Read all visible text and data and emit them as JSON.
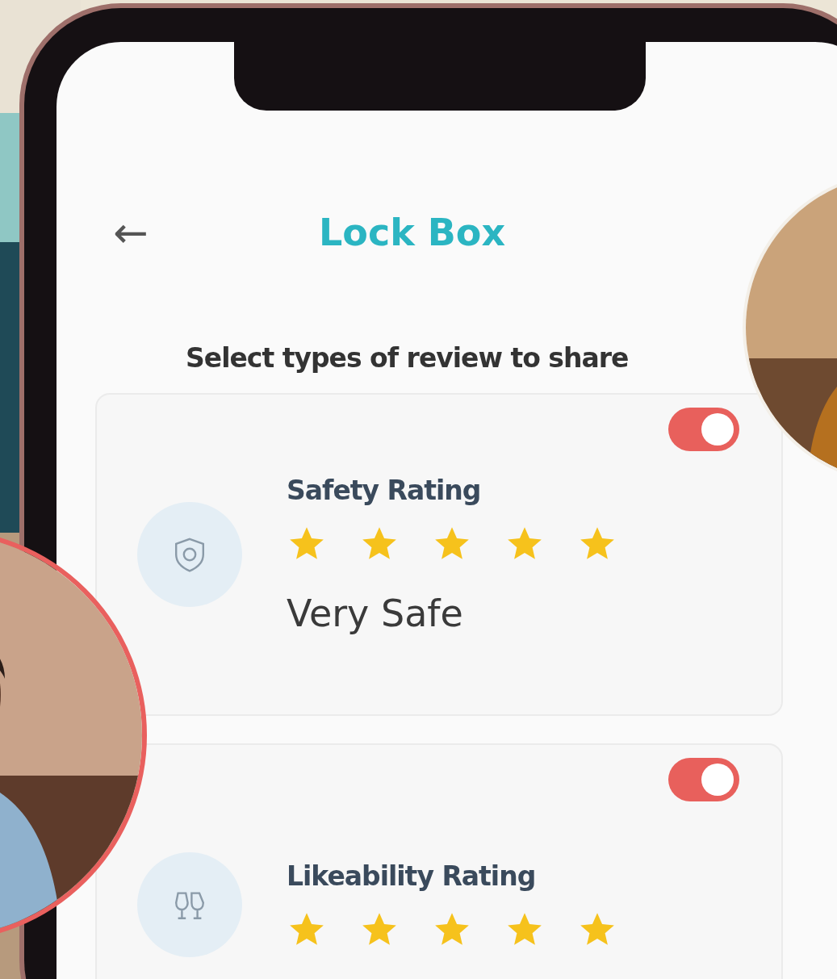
{
  "header": {
    "back_icon": "←",
    "title": "Lock Box"
  },
  "subtitle": "Select types of review to share",
  "reviews": [
    {
      "kind": "safety",
      "title": "Safety Rating",
      "stars": 5,
      "on": true,
      "verdict": "Very Safe"
    },
    {
      "kind": "likeability",
      "title": "Likeability Rating",
      "stars": 5,
      "on": true
    }
  ]
}
